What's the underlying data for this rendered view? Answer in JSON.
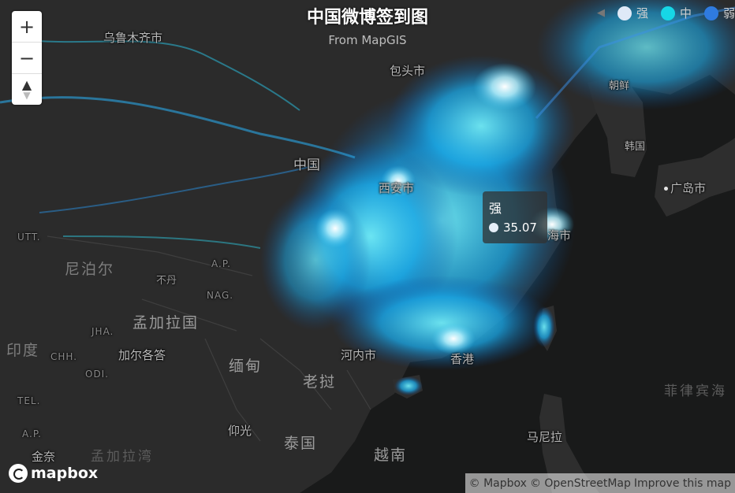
{
  "title": "中国微博签到图",
  "subtitle": "From MapGIS",
  "legend": {
    "items": [
      {
        "label": "强",
        "color": "#dfe9f7"
      },
      {
        "label": "中",
        "color": "#16d7e6"
      },
      {
        "label": "弱",
        "color": "#2f7be0"
      }
    ]
  },
  "tooltip": {
    "name": "强",
    "value": "35.07",
    "dot_color": "#e6eef8"
  },
  "controls": {
    "zoom_in": "+",
    "zoom_out": "−",
    "compass": "▲"
  },
  "logo": {
    "text": "mapbox"
  },
  "attribution": {
    "mapbox": "© Mapbox",
    "osm": "© OpenStreetMap",
    "improve": "Improve this map"
  },
  "places": {
    "urumqi": "乌鲁木齐市",
    "baotou": "包头市",
    "korea_north": "朝鲜",
    "korea_south": "韩国",
    "hiroshima": "广岛市",
    "china": "中国",
    "xian": "西安市",
    "shanghai": "海市",
    "nepal": "尼泊尔",
    "bhutan": "不丹",
    "bangladesh": "孟加拉国",
    "india": "印度",
    "kolkata": "加尔各答",
    "myanmar": "缅甸",
    "laos": "老挝",
    "hanoi": "河内市",
    "hongkong": "香港",
    "thailand": "泰国",
    "vietnam": "越南",
    "yangon": "仰光",
    "manila": "马尼拉",
    "philippine_sea": "菲律宾海",
    "bay_of_bengal": "孟加拉湾",
    "chennai": "金奈",
    "code_utt": "UTT.",
    "code_ap_west": "A.P.",
    "code_nag": "NAG.",
    "code_jha": "JHA.",
    "code_chh": "CHH.",
    "code_odi": "ODI.",
    "code_tel": "TEL.",
    "code_ap_south": "A.P.",
    "code_ap_east": "A.P."
  }
}
